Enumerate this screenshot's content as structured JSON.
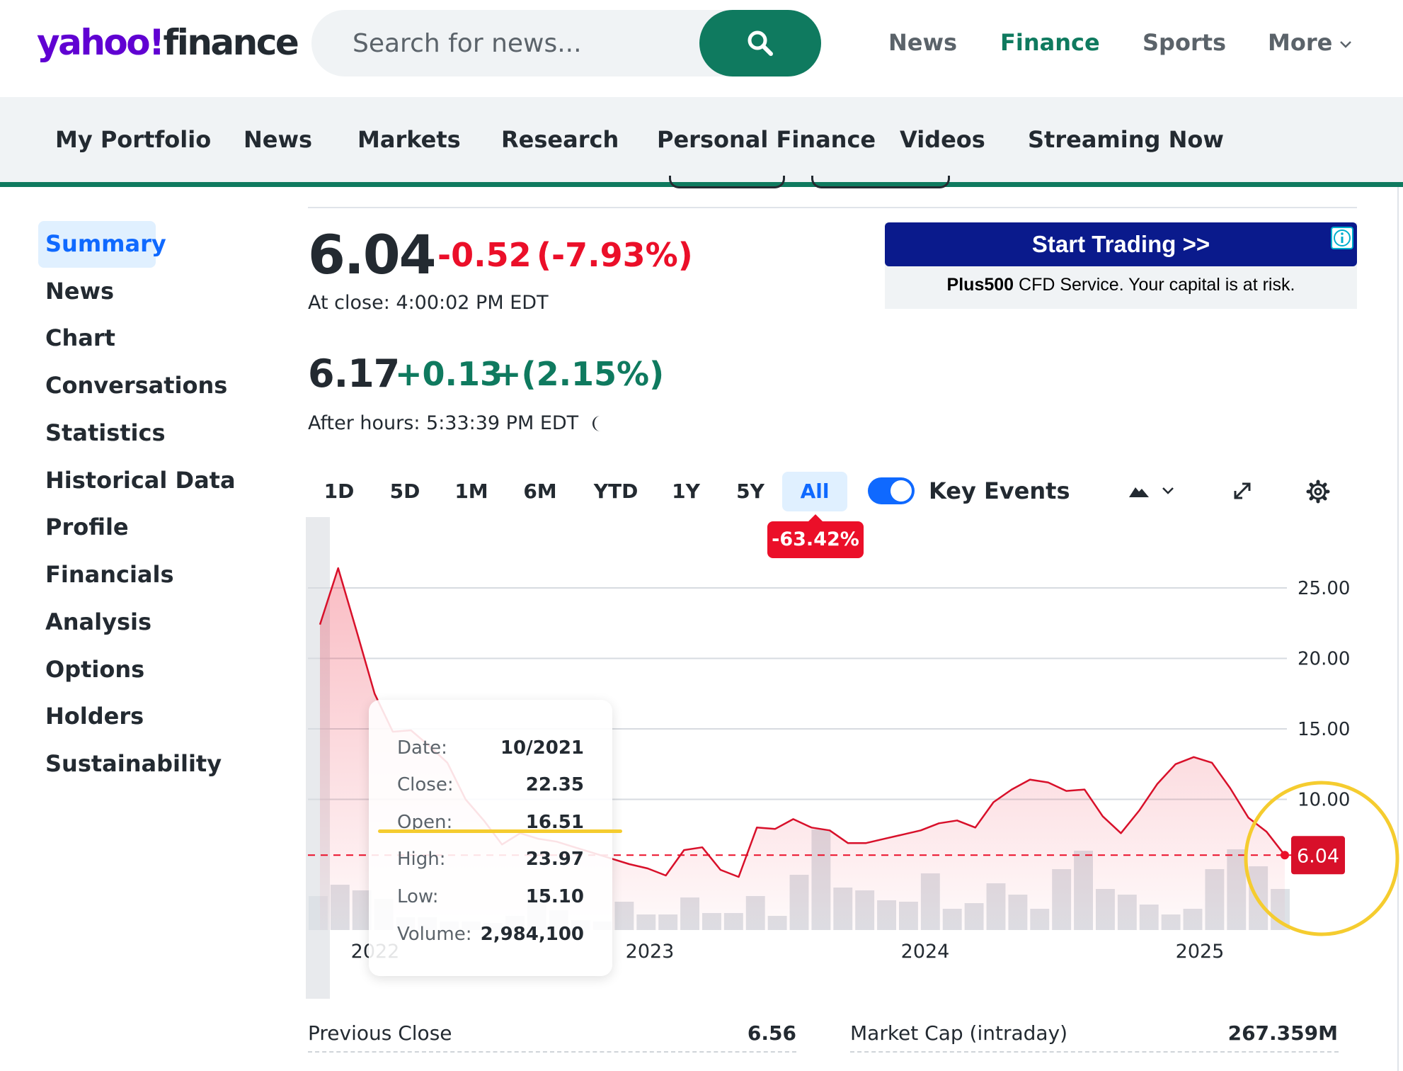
{
  "header": {
    "logo_brand": "yahoo!",
    "logo_product": "finance",
    "search_placeholder": "Search for news...",
    "nav": [
      {
        "label": "News"
      },
      {
        "label": "Finance"
      },
      {
        "label": "Sports"
      },
      {
        "label": "More"
      }
    ],
    "active_nav": "Finance"
  },
  "subnav": {
    "items": [
      "My Portfolio",
      "News",
      "Markets",
      "Research",
      "Personal Finance",
      "Videos",
      "Streaming Now"
    ]
  },
  "sidebar": {
    "items": [
      "Summary",
      "News",
      "Chart",
      "Conversations",
      "Statistics",
      "Historical Data",
      "Profile",
      "Financials",
      "Analysis",
      "Options",
      "Holders",
      "Sustainability"
    ],
    "active": "Summary"
  },
  "quote": {
    "price": "6.04",
    "change": "-0.52",
    "change_pct": "(-7.93%)",
    "close_time": "At close: 4:00:02 PM EDT",
    "after_hours_price": "6.17",
    "after_hours_change": "+0.13",
    "after_hours_change_pct": "+(2.15%)",
    "after_hours_time": "After hours: 5:33:39 PM EDT"
  },
  "ad": {
    "button_label": "Start Trading >>",
    "brand": "Plus500",
    "disclaimer": " CFD Service. Your capital is at risk."
  },
  "range_tabs": [
    "1D",
    "5D",
    "1M",
    "6M",
    "YTD",
    "1Y",
    "5Y",
    "All"
  ],
  "active_range": "All",
  "range_performance": "-63.42%",
  "key_events_label": "Key Events",
  "key_events_on": true,
  "tooltip": {
    "rows": [
      {
        "key": "Date:",
        "value": "10/2021"
      },
      {
        "key": "Close:",
        "value": "22.35"
      },
      {
        "key": "Open:",
        "value": "16.51"
      },
      {
        "key": "High:",
        "value": "23.97"
      },
      {
        "key": "Low:",
        "value": "15.10"
      },
      {
        "key": "Volume:",
        "value": "2,984,100"
      }
    ]
  },
  "stats": {
    "previous_close_label": "Previous Close",
    "previous_close_value": "6.56",
    "market_cap_label": "Market Cap (intraday)",
    "market_cap_value": "267.359M"
  },
  "colors": {
    "brand_purple": "#6001d2",
    "accent_green": "#0f7a5f",
    "negative_red": "#eb0f29",
    "link_blue": "#0f69ff",
    "highlight_yellow": "#f5cc2f"
  },
  "chart_data": {
    "type": "line",
    "title": "",
    "xlabel": "",
    "ylabel": "",
    "x_ticks": [
      "2022",
      "2023",
      "2024",
      "2025"
    ],
    "y_ticks": [
      "25.00",
      "20.00",
      "15.00",
      "10.00"
    ],
    "ylim": [
      0,
      28
    ],
    "last_price_label": "6.04",
    "reference_line": 6.04,
    "series": [
      {
        "values": [
          22.4,
          26.4,
          22.0,
          17.5,
          14.8,
          14.9,
          13.8,
          12.6,
          10.0,
          8.5,
          6.8,
          7.6,
          7.2,
          7.0,
          6.6,
          6.2,
          5.8,
          5.4,
          5.1,
          4.6,
          6.4,
          6.6,
          5.0,
          4.5,
          8.0,
          7.9,
          8.6,
          8.0,
          7.8,
          6.9,
          6.9,
          7.2,
          7.5,
          7.8,
          8.3,
          8.5,
          8.0,
          9.8,
          10.7,
          11.4,
          11.2,
          10.6,
          10.7,
          8.8,
          7.6,
          9.2,
          11.1,
          12.5,
          13.0,
          12.6,
          10.8,
          8.7,
          7.7,
          6.04
        ]
      }
    ],
    "volume": [
      2.4,
      3.2,
      2.8,
      2.2,
      0.9,
      0.9,
      0.6,
      0.6,
      0.5,
      1.0,
      2.9,
      1.4,
      0.7,
      0.6,
      2.0,
      1.1,
      1.1,
      2.3,
      1.2,
      1.2,
      2.4,
      1.0,
      3.9,
      7.1,
      3.0,
      2.8,
      2.1,
      2.0,
      4.0,
      1.5,
      1.9,
      3.3,
      2.5,
      1.5,
      4.3,
      5.6,
      2.9,
      2.5,
      1.8,
      1.1,
      1.5,
      4.3,
      5.7,
      4.5,
      2.9
    ]
  }
}
